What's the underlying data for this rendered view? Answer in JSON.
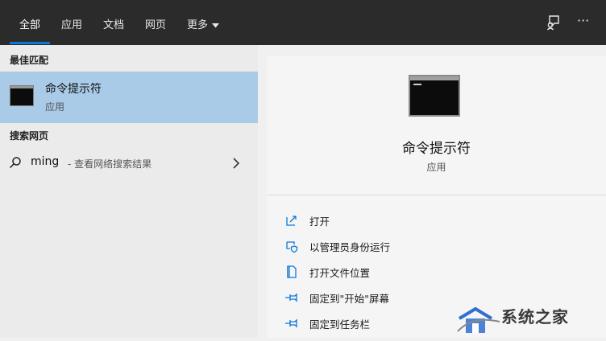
{
  "tabs": [
    {
      "label": "全部",
      "active": true
    },
    {
      "label": "应用"
    },
    {
      "label": "文档"
    },
    {
      "label": "网页"
    },
    {
      "label": "更多"
    }
  ],
  "header_icons": [
    "feedback-icon",
    "more-options-icon"
  ],
  "more_options_glyph": "···",
  "accent": "#0a78d7",
  "left": {
    "best_match_heading": "最佳匹配",
    "best_match": {
      "title": "命令提示符",
      "subtitle": "应用",
      "icon": "terminal-icon"
    },
    "web_heading": "搜索网页",
    "web_result": {
      "query": "ming",
      "hint": "- 查看网络搜索结果"
    }
  },
  "detail": {
    "app_name": "命令提示符",
    "app_type": "应用",
    "actions": [
      {
        "label": "打开",
        "icon": "open-icon"
      },
      {
        "label": "以管理员身份运行",
        "icon": "shield-run-icon"
      },
      {
        "label": "打开文件位置",
        "icon": "file-location-icon"
      },
      {
        "label": "固定到\"开始\"屏幕",
        "icon": "pin-icon"
      },
      {
        "label": "固定到任务栏",
        "icon": "pin-icon"
      }
    ]
  },
  "watermark": {
    "text": "系统之家"
  }
}
